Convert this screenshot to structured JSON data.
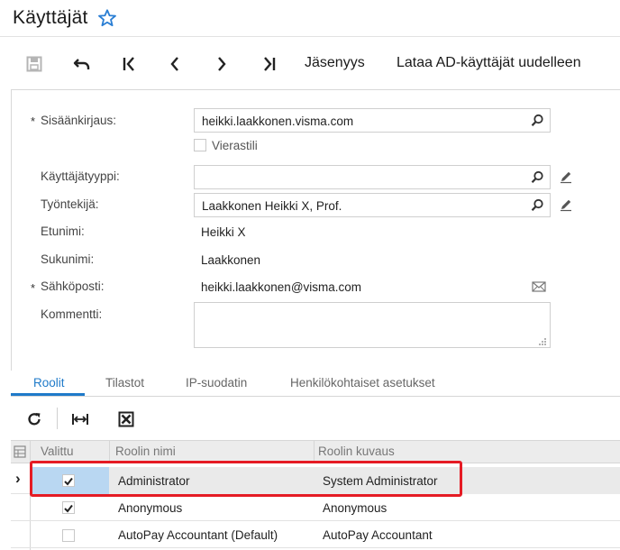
{
  "header": {
    "title": "Käyttäjät"
  },
  "toolbar": {
    "icons": [
      "save-icon",
      "undo-icon",
      "first-record-icon",
      "previous-record-icon",
      "next-record-icon",
      "last-record-icon"
    ],
    "membership_label": "Jäsenyys",
    "reload_ad_label": "Lataa AD-käyttäjät uudelleen"
  },
  "form": {
    "login": {
      "label": "Sisäänkirjaus:",
      "value": "heikki.laakkonen.visma.com",
      "required": true
    },
    "guest_account": {
      "label": "Vierastili",
      "checked": false
    },
    "user_type": {
      "label": "Käyttäjätyyppi:",
      "value": ""
    },
    "employee": {
      "label": "Työntekijä:",
      "value": "Laakkonen Heikki X, Prof."
    },
    "first_name": {
      "label": "Etunimi:",
      "value": "Heikki X"
    },
    "last_name": {
      "label": "Sukunimi:",
      "value": "Laakkonen"
    },
    "email": {
      "label": "Sähköposti:",
      "value": "heikki.laakkonen@visma.com",
      "required": true
    },
    "comment": {
      "label": "Kommentti:",
      "value": ""
    },
    "required_mark": "*"
  },
  "tabs": [
    {
      "label": "Roolit",
      "active": true
    },
    {
      "label": "Tilastot",
      "active": false
    },
    {
      "label": "IP-suodatin",
      "active": false
    },
    {
      "label": "Henkilökohtaiset asetukset",
      "active": false
    }
  ],
  "grid": {
    "columns": [
      "Valittu",
      "Roolin nimi",
      "Roolin kuvaus"
    ],
    "rows": [
      {
        "selected": true,
        "name": "Administrator",
        "description": "System Administrator",
        "current": true
      },
      {
        "selected": true,
        "name": "Anonymous",
        "description": "Anonymous",
        "current": false
      },
      {
        "selected": false,
        "name": "AutoPay Accountant (Default)",
        "description": "AutoPay Accountant",
        "current": false
      }
    ],
    "current_row_marker": "›"
  },
  "colors": {
    "accent": "#1f7ac9",
    "selection": "#b9d7f2",
    "highlight": "#e51b24",
    "star": "#2b7fd4"
  }
}
